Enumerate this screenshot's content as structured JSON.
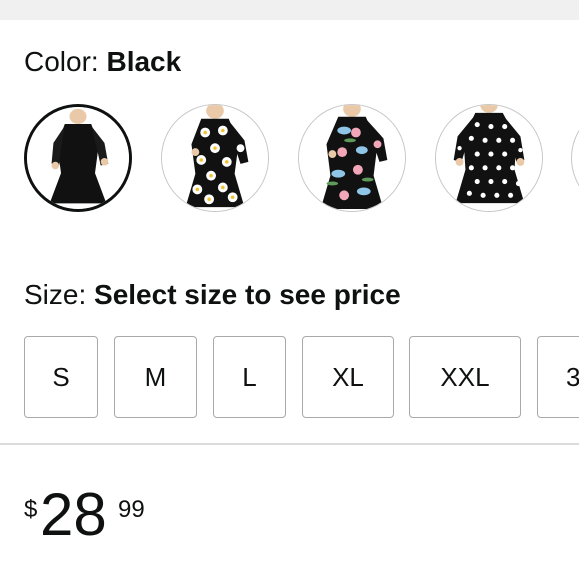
{
  "color": {
    "label": "Color:",
    "selected_value": "Black",
    "swatches": [
      {
        "name": "black-dress",
        "pattern": "solid-black",
        "selected": true
      },
      {
        "name": "daisy-print-dress",
        "pattern": "white-daisy-on-black",
        "selected": false
      },
      {
        "name": "floral-print-dress",
        "pattern": "blue-pink-floral-on-black",
        "selected": false
      },
      {
        "name": "polka-dot-dress",
        "pattern": "white-dots-on-black",
        "selected": false
      },
      {
        "name": "next-swatch",
        "pattern": "partially-visible",
        "selected": false
      }
    ]
  },
  "size": {
    "label": "Size:",
    "prompt": "Select size to see price",
    "options": [
      "S",
      "M",
      "L",
      "XL",
      "XXL",
      "3"
    ]
  },
  "price": {
    "symbol": "$",
    "whole": "28",
    "fraction": "99"
  },
  "colors": {
    "text": "#0f1111",
    "border": "#a9a9a9",
    "selected_border": "#0f1111",
    "divider": "#dcdcdc"
  }
}
